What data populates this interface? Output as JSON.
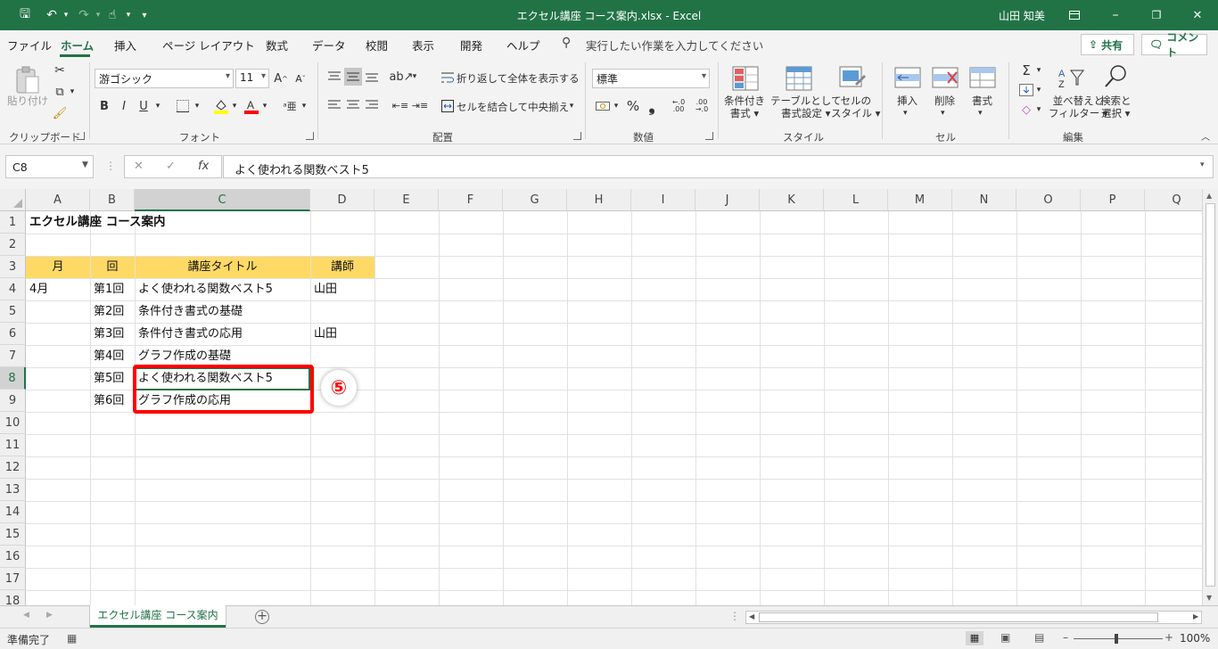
{
  "window": {
    "title": "エクセル講座 コース案内.xlsx  -  Excel",
    "user": "山田 知美",
    "minimize": "–",
    "restore": "❐",
    "close": "✕"
  },
  "quick_access": {
    "save_icon": "🖫",
    "undo_icon": "↶",
    "redo_icon": "↷",
    "touch_icon": "☝",
    "more_icon": "▾"
  },
  "tabs": [
    "ファイル",
    "ホーム",
    "挿入",
    "ページ レイアウト",
    "数式",
    "データ",
    "校閲",
    "表示",
    "開発",
    "ヘルプ"
  ],
  "active_tab": "ホーム",
  "tell_me": "実行したい作業を入力してください",
  "share_label": "共有",
  "comment_label": "コメント",
  "ribbon": {
    "clipboard": {
      "paste_label": "貼り付け",
      "group_label": "クリップボード"
    },
    "font": {
      "font_name": "游ゴシック",
      "font_size": "11",
      "bold": "B",
      "italic": "I",
      "underline": "U",
      "group_label": "フォント"
    },
    "alignment": {
      "wrap_text": "折り返して全体を表示する",
      "merge_center": "セルを結合して中央揃え",
      "group_label": "配置"
    },
    "number": {
      "format": "標準",
      "percent": "%",
      "comma": "❟",
      "group_label": "数値"
    },
    "styles": {
      "conditional": [
        "条件付き",
        "書式 ▾"
      ],
      "table": [
        "テーブルとして",
        "書式設定 ▾"
      ],
      "cell_styles": [
        "セルの",
        "スタイル ▾"
      ],
      "group_label": "スタイル"
    },
    "cells": {
      "insert": "挿入",
      "delete": "削除",
      "format": "書式",
      "group_label": "セル"
    },
    "editing": {
      "sort_filter": [
        "並べ替えと",
        "フィルター ▾"
      ],
      "find_select": [
        "検索と",
        "選択 ▾"
      ],
      "group_label": "編集"
    }
  },
  "formula_bar": {
    "name_box": "C8",
    "cancel": "✕",
    "enter": "✓",
    "fx": "fx",
    "content": "よく使われる関数ベスト5"
  },
  "columns": [
    "A",
    "B",
    "C",
    "D",
    "E",
    "F",
    "G",
    "H",
    "I",
    "J",
    "K",
    "L",
    "M",
    "N",
    "O",
    "P",
    "Q"
  ],
  "selected_column": "C",
  "rows": [
    "1",
    "2",
    "3",
    "4",
    "5",
    "6",
    "7",
    "8",
    "9",
    "10",
    "11",
    "12",
    "13",
    "14",
    "15",
    "16",
    "17",
    "18"
  ],
  "selected_row": "8",
  "cells": {
    "A1": "エクセル講座 コース案内",
    "A3": "月",
    "B3": "回",
    "C3": "講座タイトル",
    "D3": "講師",
    "A4": "4月",
    "B4": "第1回",
    "C4": "よく使われる関数ベスト5",
    "D4": "山田",
    "B5": "第2回",
    "C5": "条件付き書式の基礎",
    "B6": "第3回",
    "C6": "条件付き書式の応用",
    "D6": "山田",
    "B7": "第4回",
    "C7": "グラフ作成の基礎",
    "B8": "第5回",
    "C8": "よく使われる関数ベスト5",
    "B9": "第6回",
    "C9": "グラフ作成の応用"
  },
  "header_fill_color": "#ffd966",
  "annotation": {
    "step": "⑤",
    "color": "#ff0000"
  },
  "sheet_tab": "エクセル講座 コース案内",
  "status": {
    "ready": "準備完了",
    "zoom": "100%",
    "zoom_minus": "–",
    "zoom_plus": "+"
  },
  "accent_color": "#217346"
}
